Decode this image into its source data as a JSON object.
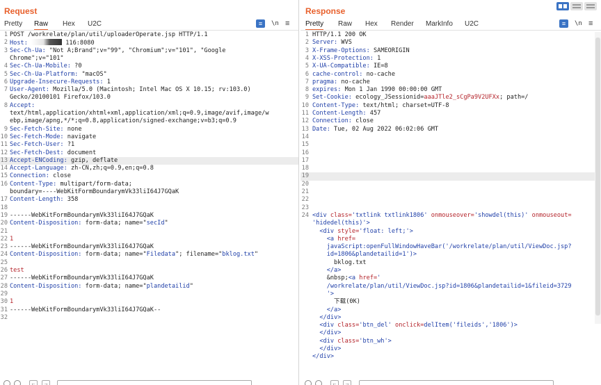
{
  "request": {
    "title": "Request",
    "tabs": [
      "Pretty",
      "Raw",
      "Hex",
      "U2C"
    ],
    "active_tab": "Raw",
    "newline_toggle": "\\n",
    "lines": [
      {
        "n": "1",
        "segs": [
          {
            "t": "POST /workrelate/plan/util/uploaderOperate.jsp HTTP/1.1",
            "c": "plain"
          }
        ]
      },
      {
        "n": "2",
        "segs": [
          {
            "t": "Host: ",
            "c": "hk"
          },
          {
            "t": "",
            "c": "redact"
          },
          {
            "t": " 116:8080",
            "c": "plain"
          }
        ]
      },
      {
        "n": "3",
        "segs": [
          {
            "t": "Sec-Ch-Ua: ",
            "c": "hk"
          },
          {
            "t": "\"Not A;Brand\";v=\"99\", \"Chromium\";v=\"101\", \"Google",
            "c": "plain"
          }
        ]
      },
      {
        "n": "",
        "segs": [
          {
            "t": "Chrome\";v=\"101\"",
            "c": "plain"
          }
        ]
      },
      {
        "n": "4",
        "segs": [
          {
            "t": "Sec-Ch-Ua-Mobile: ",
            "c": "hk"
          },
          {
            "t": "?0",
            "c": "plain"
          }
        ]
      },
      {
        "n": "5",
        "segs": [
          {
            "t": "Sec-Ch-Ua-Platform: ",
            "c": "hk"
          },
          {
            "t": "\"macOS\"",
            "c": "plain"
          }
        ]
      },
      {
        "n": "6",
        "segs": [
          {
            "t": "Upgrade-Insecure-Requests: ",
            "c": "hk"
          },
          {
            "t": "1",
            "c": "plain"
          }
        ]
      },
      {
        "n": "7",
        "segs": [
          {
            "t": "User-Agent: ",
            "c": "hk"
          },
          {
            "t": "Mozilla/5.0 (Macintosh; Intel Mac OS X 10.15; rv:103.0)",
            "c": "plain"
          }
        ]
      },
      {
        "n": "",
        "segs": [
          {
            "t": "Gecko/20100101 Firefox/103.0",
            "c": "plain"
          }
        ]
      },
      {
        "n": "8",
        "segs": [
          {
            "t": "Accept:",
            "c": "hk"
          }
        ]
      },
      {
        "n": "",
        "segs": [
          {
            "t": "text/html,application/xhtml+xml,application/xml;q=0.9,image/avif,image/w",
            "c": "plain"
          }
        ]
      },
      {
        "n": "",
        "segs": [
          {
            "t": "ebp,image/apng,*/*;q=0.8,application/signed-exchange;v=b3;q=0.9",
            "c": "plain"
          }
        ]
      },
      {
        "n": "9",
        "segs": [
          {
            "t": "Sec-Fetch-Site: ",
            "c": "hk"
          },
          {
            "t": "none",
            "c": "plain"
          }
        ]
      },
      {
        "n": "10",
        "segs": [
          {
            "t": "Sec-Fetch-Mode: ",
            "c": "hk"
          },
          {
            "t": "navigate",
            "c": "plain"
          }
        ]
      },
      {
        "n": "11",
        "segs": [
          {
            "t": "Sec-Fetch-User: ",
            "c": "hk"
          },
          {
            "t": "?1",
            "c": "plain"
          }
        ]
      },
      {
        "n": "12",
        "segs": [
          {
            "t": "Sec-Fetch-Dest: ",
            "c": "hk"
          },
          {
            "t": "document",
            "c": "plain"
          }
        ]
      },
      {
        "n": "13",
        "hl": true,
        "segs": [
          {
            "t": "Accept-ENCoding: ",
            "c": "hk"
          },
          {
            "t": "gzip, deflate",
            "c": "plain"
          }
        ]
      },
      {
        "n": "14",
        "segs": [
          {
            "t": "Accept-Language: ",
            "c": "hk"
          },
          {
            "t": "zh-CN,zh;q=0.9,en;q=0.8",
            "c": "plain"
          }
        ]
      },
      {
        "n": "15",
        "segs": [
          {
            "t": "Connection: ",
            "c": "hk"
          },
          {
            "t": "close",
            "c": "plain"
          }
        ]
      },
      {
        "n": "16",
        "segs": [
          {
            "t": "Content-Type: ",
            "c": "hk"
          },
          {
            "t": "multipart/form-data;",
            "c": "plain"
          }
        ]
      },
      {
        "n": "",
        "segs": [
          {
            "t": "boundary=----WebKitFormBoundarymVk33liI64J7GQaK",
            "c": "plain"
          }
        ]
      },
      {
        "n": "17",
        "segs": [
          {
            "t": "Content-Length: ",
            "c": "hk"
          },
          {
            "t": "358",
            "c": "plain"
          }
        ]
      },
      {
        "n": "18",
        "segs": []
      },
      {
        "n": "19",
        "segs": [
          {
            "t": "------WebKitFormBoundarymVk33liI64J7GQaK",
            "c": "plain"
          }
        ]
      },
      {
        "n": "20",
        "segs": [
          {
            "t": "Content-Disposition: ",
            "c": "hk"
          },
          {
            "t": "form-data; name=\"",
            "c": "plain"
          },
          {
            "t": "secId",
            "c": "blue"
          },
          {
            "t": "\"",
            "c": "plain"
          }
        ]
      },
      {
        "n": "21",
        "segs": []
      },
      {
        "n": "22",
        "segs": [
          {
            "t": "1",
            "c": "red"
          }
        ]
      },
      {
        "n": "23",
        "segs": [
          {
            "t": "------WebKitFormBoundarymVk33liI64J7GQaK",
            "c": "plain"
          }
        ]
      },
      {
        "n": "24",
        "segs": [
          {
            "t": "Content-Disposition: ",
            "c": "hk"
          },
          {
            "t": "form-data; name=\"",
            "c": "plain"
          },
          {
            "t": "Filedata",
            "c": "blue"
          },
          {
            "t": "\"; filename=\"",
            "c": "plain"
          },
          {
            "t": "bklog.txt",
            "c": "blue"
          },
          {
            "t": "\"",
            "c": "plain"
          }
        ]
      },
      {
        "n": "25",
        "segs": []
      },
      {
        "n": "26",
        "segs": [
          {
            "t": "test",
            "c": "red"
          }
        ]
      },
      {
        "n": "27",
        "segs": [
          {
            "t": "------WebKitFormBoundarymVk33liI64J7GQaK",
            "c": "plain"
          }
        ]
      },
      {
        "n": "28",
        "segs": [
          {
            "t": "Content-Disposition: ",
            "c": "hk"
          },
          {
            "t": "form-data; name=\"",
            "c": "plain"
          },
          {
            "t": "plandetailid",
            "c": "blue"
          },
          {
            "t": "\"",
            "c": "plain"
          }
        ]
      },
      {
        "n": "29",
        "segs": []
      },
      {
        "n": "30",
        "segs": [
          {
            "t": "1",
            "c": "red"
          }
        ]
      },
      {
        "n": "31",
        "segs": [
          {
            "t": "------WebKitFormBoundarymVk33liI64J7GQaK--",
            "c": "plain"
          }
        ]
      },
      {
        "n": "32",
        "segs": []
      }
    ]
  },
  "response": {
    "title": "Response",
    "tabs": [
      "Pretty",
      "Raw",
      "Hex",
      "Render",
      "MarkInfo",
      "U2C"
    ],
    "active_tab": "Pretty",
    "newline_toggle": "\\n",
    "lines": [
      {
        "n": "1",
        "segs": [
          {
            "t": "HTTP/1.1 200 OK",
            "c": "plain"
          }
        ]
      },
      {
        "n": "2",
        "segs": [
          {
            "t": "Server: ",
            "c": "hk"
          },
          {
            "t": "WVS",
            "c": "plain"
          }
        ]
      },
      {
        "n": "3",
        "segs": [
          {
            "t": "X-Frame-Options: ",
            "c": "hk"
          },
          {
            "t": "SAMEORIGIN",
            "c": "plain"
          }
        ]
      },
      {
        "n": "4",
        "segs": [
          {
            "t": "X-XSS-Protection: ",
            "c": "hk"
          },
          {
            "t": "1",
            "c": "plain"
          }
        ]
      },
      {
        "n": "5",
        "segs": [
          {
            "t": "X-UA-Compatible: ",
            "c": "hk"
          },
          {
            "t": "IE=8",
            "c": "plain"
          }
        ]
      },
      {
        "n": "6",
        "segs": [
          {
            "t": "cache-control: ",
            "c": "hk"
          },
          {
            "t": "no-cache",
            "c": "plain"
          }
        ]
      },
      {
        "n": "7",
        "segs": [
          {
            "t": "pragma: ",
            "c": "hk"
          },
          {
            "t": "no-cache",
            "c": "plain"
          }
        ]
      },
      {
        "n": "8",
        "segs": [
          {
            "t": "expires: ",
            "c": "hk"
          },
          {
            "t": "Mon 1 Jan 1990 00:00:00 GMT",
            "c": "plain"
          }
        ]
      },
      {
        "n": "9",
        "segs": [
          {
            "t": "Set-Cookie: ",
            "c": "hk"
          },
          {
            "t": "ecology_JSessionid",
            "c": "plain"
          },
          {
            "t": "=",
            "c": "plain"
          },
          {
            "t": "aaaJTle2_sCgPa9V2UFXx",
            "c": "red"
          },
          {
            "t": "; path=/",
            "c": "plain"
          }
        ]
      },
      {
        "n": "10",
        "segs": [
          {
            "t": "Content-Type: ",
            "c": "hk"
          },
          {
            "t": "text/html; charset=UTF-8",
            "c": "plain"
          }
        ]
      },
      {
        "n": "11",
        "segs": [
          {
            "t": "Content-Length: ",
            "c": "hk"
          },
          {
            "t": "457",
            "c": "plain"
          }
        ]
      },
      {
        "n": "12",
        "segs": [
          {
            "t": "Connection: ",
            "c": "hk"
          },
          {
            "t": "close",
            "c": "plain"
          }
        ]
      },
      {
        "n": "13",
        "segs": [
          {
            "t": "Date: ",
            "c": "hk"
          },
          {
            "t": "Tue, 02 Aug 2022 06:02:06 GMT",
            "c": "plain"
          }
        ]
      },
      {
        "n": "14",
        "segs": []
      },
      {
        "n": "15",
        "segs": []
      },
      {
        "n": "16",
        "segs": []
      },
      {
        "n": "17",
        "segs": []
      },
      {
        "n": "18",
        "segs": []
      },
      {
        "n": "19",
        "hl": true,
        "segs": []
      },
      {
        "n": "20",
        "segs": []
      },
      {
        "n": "21",
        "segs": []
      },
      {
        "n": "22",
        "segs": []
      },
      {
        "n": "23",
        "segs": []
      },
      {
        "n": "24",
        "segs": [
          {
            "t": "<div ",
            "c": "blue"
          },
          {
            "t": "class=",
            "c": "red"
          },
          {
            "t": "'txtlink txtlink1806' ",
            "c": "blue"
          },
          {
            "t": "onmouseover=",
            "c": "red"
          },
          {
            "t": "'showdel(this)' ",
            "c": "blue"
          },
          {
            "t": "onmouseout=",
            "c": "red"
          }
        ]
      },
      {
        "n": "",
        "segs": [
          {
            "t": "'hidedel(this)'",
            "c": "blue"
          },
          {
            "t": ">",
            "c": "blue"
          }
        ]
      },
      {
        "n": "",
        "segs": [
          {
            "t": "  <div ",
            "c": "blue"
          },
          {
            "t": "style=",
            "c": "red"
          },
          {
            "t": "'float: left;'",
            "c": "blue"
          },
          {
            "t": ">",
            "c": "blue"
          }
        ]
      },
      {
        "n": "",
        "segs": [
          {
            "t": "    <a ",
            "c": "blue"
          },
          {
            "t": "href=",
            "c": "red"
          }
        ]
      },
      {
        "n": "",
        "segs": [
          {
            "t": "    javaScript:openFullWindowHaveBar('/workrelate/plan/util/ViewDoc.jsp?",
            "c": "blue"
          }
        ]
      },
      {
        "n": "",
        "segs": [
          {
            "t": "    id=1806&plandetailid=1')",
            "c": "blue"
          },
          {
            "t": ">",
            "c": "blue"
          }
        ]
      },
      {
        "n": "",
        "segs": [
          {
            "t": "      bklog.txt",
            "c": "plain"
          }
        ]
      },
      {
        "n": "",
        "segs": [
          {
            "t": "    </a>",
            "c": "blue"
          }
        ]
      },
      {
        "n": "",
        "segs": [
          {
            "t": "    &nbsp;",
            "c": "plain"
          },
          {
            "t": "<a ",
            "c": "blue"
          },
          {
            "t": "href=",
            "c": "red"
          },
          {
            "t": "'",
            "c": "blue"
          }
        ]
      },
      {
        "n": "",
        "segs": [
          {
            "t": "    /workrelate/plan/util/ViewDoc.jsp?id=1806&plandetailid=1&fileid=3729",
            "c": "blue"
          }
        ]
      },
      {
        "n": "",
        "segs": [
          {
            "t": "    '",
            "c": "blue"
          },
          {
            "t": ">",
            "c": "blue"
          }
        ]
      },
      {
        "n": "",
        "segs": [
          {
            "t": "      下载(0K)",
            "c": "plain"
          }
        ]
      },
      {
        "n": "",
        "segs": [
          {
            "t": "    </a>",
            "c": "blue"
          }
        ]
      },
      {
        "n": "",
        "segs": [
          {
            "t": "  </div>",
            "c": "blue"
          }
        ]
      },
      {
        "n": "",
        "segs": [
          {
            "t": "  <div ",
            "c": "blue"
          },
          {
            "t": "class=",
            "c": "red"
          },
          {
            "t": "'btn_del' ",
            "c": "blue"
          },
          {
            "t": "onclick=",
            "c": "red"
          },
          {
            "t": "delItem('fileids','1806')",
            "c": "blue"
          },
          {
            "t": ">",
            "c": "blue"
          }
        ]
      },
      {
        "n": "",
        "segs": [
          {
            "t": "  </div>",
            "c": "blue"
          }
        ]
      },
      {
        "n": "",
        "segs": [
          {
            "t": "  <div ",
            "c": "blue"
          },
          {
            "t": "class=",
            "c": "red"
          },
          {
            "t": "'btn_wh'",
            "c": "blue"
          },
          {
            "t": ">",
            "c": "blue"
          }
        ]
      },
      {
        "n": "",
        "segs": [
          {
            "t": "  </div>",
            "c": "blue"
          }
        ]
      },
      {
        "n": "",
        "segs": [
          {
            "t": "</div>",
            "c": "blue"
          }
        ]
      }
    ]
  },
  "colors": {
    "accent": "#e8602c",
    "header_key": "#1f3fa8",
    "value_red": "#b4232a",
    "toggle_blue": "#3a73c4"
  },
  "icons": {
    "wrap": "word-wrap-icon",
    "menu": "hamburger-menu-icon",
    "layout": "layout-toggle-icon",
    "settings": "gear-icon",
    "help": "help-icon"
  }
}
